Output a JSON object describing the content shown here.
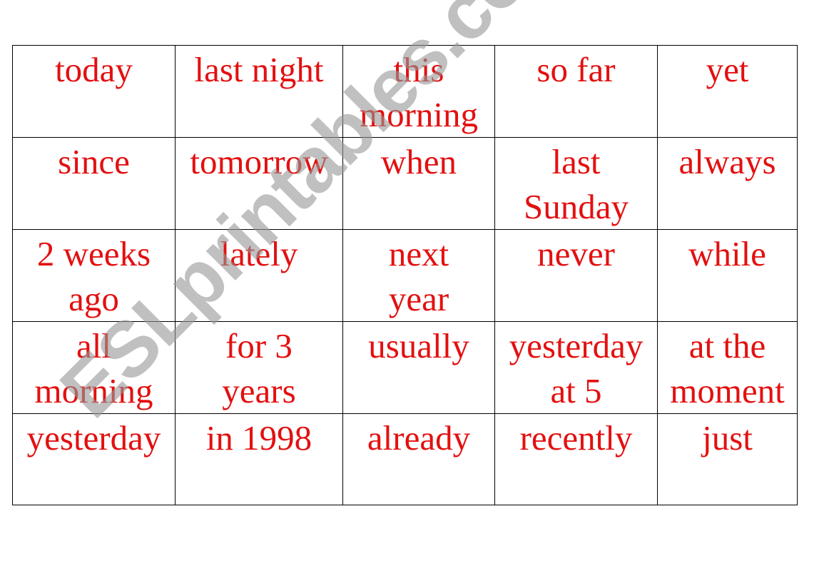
{
  "worksheet": {
    "rows": [
      [
        "today",
        "last night",
        "this\nmorning",
        "so far",
        "yet"
      ],
      [
        "since",
        "tomorrow",
        "when",
        "last\nSunday",
        "always"
      ],
      [
        "2 weeks\nago",
        "lately",
        "next\nyear",
        "never",
        "while"
      ],
      [
        "all\nmorning",
        "for 3\nyears",
        "usually",
        "yesterday\nat 5",
        "at the\nmoment"
      ],
      [
        "yesterday",
        "in 1998",
        "already",
        "recently",
        "just"
      ]
    ],
    "text_color": "#e31010"
  },
  "watermark": {
    "text": "ESLprintables.com"
  }
}
